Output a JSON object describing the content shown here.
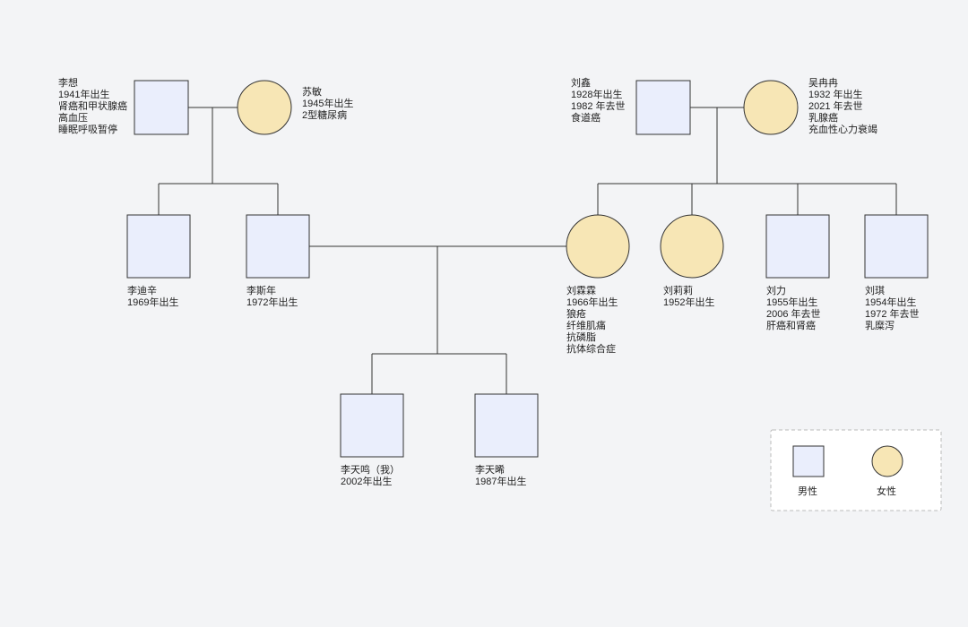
{
  "legend": {
    "male": "男性",
    "female": "女性"
  },
  "people": {
    "lixiang": {
      "lines": [
        "李想",
        "1941年出生",
        "肾癌和甲状腺癌",
        "高血压",
        "睡眠呼吸暂停"
      ]
    },
    "sumin": {
      "lines": [
        "苏敏",
        "1945年出生",
        "2型糖尿病"
      ]
    },
    "liuxin": {
      "lines": [
        "刘鑫",
        "1928年出生",
        "1982 年去世",
        "食道癌"
      ]
    },
    "wuranran": {
      "lines": [
        "吴冉冉",
        "1932 年出生",
        "2021 年去世",
        "乳腺癌",
        "充血性心力衰竭"
      ]
    },
    "lidixin": {
      "lines": [
        "李迪辛",
        "1969年出生"
      ]
    },
    "lisinian": {
      "lines": [
        "李斯年",
        "1972年出生"
      ]
    },
    "liulinlin": {
      "lines": [
        "刘霖霖",
        "1966年出生",
        "狼疮",
        "纤维肌痛",
        "抗磷脂",
        "抗体综合症"
      ]
    },
    "liulili": {
      "lines": [
        "刘莉莉",
        "1952年出生"
      ]
    },
    "liuli": {
      "lines": [
        "刘力",
        "1955年出生",
        "2006 年去世",
        "肝癌和肾癌"
      ]
    },
    "liuqi": {
      "lines": [
        "刘琪",
        "1954年出生",
        "1972 年去世",
        "乳糜泻"
      ]
    },
    "litianming": {
      "lines": [
        "李天鸣（我）",
        "2002年出生"
      ]
    },
    "litianxi": {
      "lines": [
        "李天晞",
        "1987年出生"
      ]
    }
  }
}
